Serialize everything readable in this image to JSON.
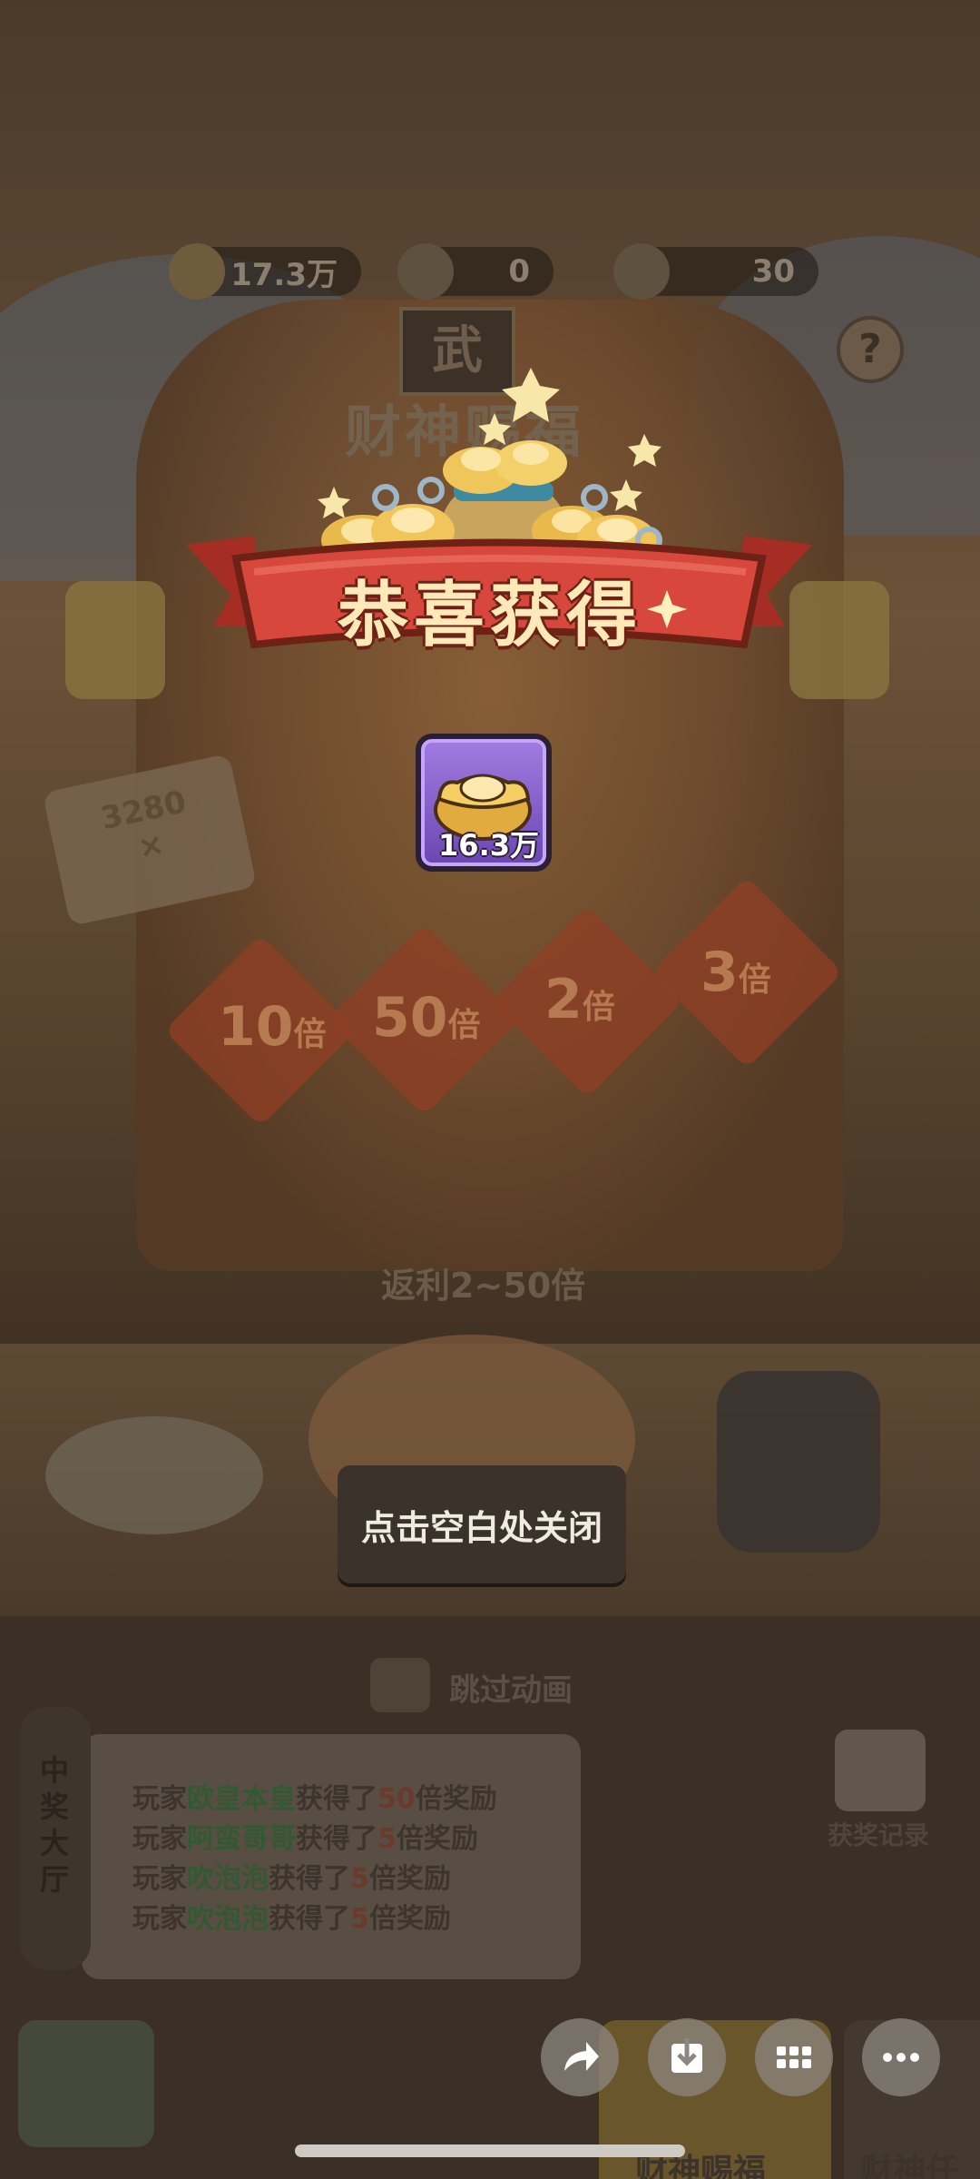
{
  "stats": {
    "ingots": "17.3万",
    "tickets": "0",
    "lanterns": "30",
    "help_icon": "?"
  },
  "background": {
    "event_title": "财神赐福",
    "temple_plaque": "武",
    "multiplier_sign": "3280",
    "multiplier_sign_suffix": "×",
    "multipliers": [
      "10",
      "50",
      "2",
      "3"
    ],
    "multiplier_unit": "倍",
    "rebate_text": "返利2~50倍",
    "skip_animation": "跳过动画",
    "hall_label": "中奖大厅",
    "feed": [
      {
        "prefix": "玩家",
        "name": "欧皇本皇",
        "mid": "获得了",
        "num": "50",
        "suffix": "倍奖励"
      },
      {
        "prefix": "玩家",
        "name": "阿蛮哥哥",
        "mid": "获得了",
        "num": "5",
        "suffix": "倍奖励"
      },
      {
        "prefix": "玩家",
        "name": "吹泡泡",
        "mid": "获得了",
        "num": "5",
        "suffix": "倍奖励"
      },
      {
        "prefix": "玩家",
        "name": "吹泡泡",
        "mid": "获得了",
        "num": "5",
        "suffix": "倍奖励"
      }
    ],
    "record_label": "获奖记录",
    "nav_tab_1": "财神赐福",
    "nav_tab_2": "财神任务"
  },
  "popup": {
    "title": "恭喜获得",
    "reward_amount": "16.3万",
    "reward_icon": "gold-ingot-icon",
    "close_hint": "点击空白处关闭"
  },
  "system_buttons": [
    "share-icon",
    "download-icon",
    "grid-icon",
    "more-icon"
  ],
  "colors": {
    "banner_red": "#d8473b",
    "title_text": "#ffe9b8",
    "card_purple": "#8d69d3",
    "gold": "#f3c458"
  }
}
